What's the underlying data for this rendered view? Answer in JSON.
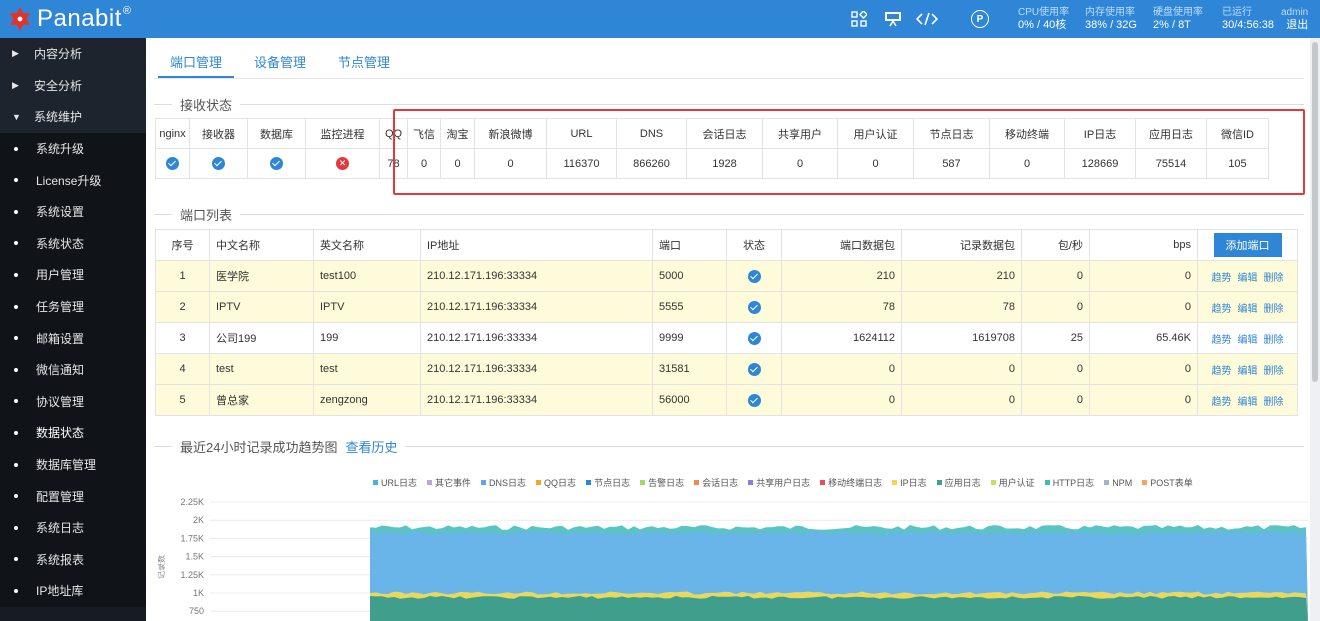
{
  "topbar": {
    "brand": "Panabit",
    "brand_mark": "®",
    "icons": [
      "apps-icon",
      "monitor-icon",
      "code-icon"
    ],
    "p_badge": "P",
    "stats": [
      {
        "label": "CPU使用率",
        "value": "0% / 40核"
      },
      {
        "label": "内存使用率",
        "value": "38% / 32G"
      },
      {
        "label": "硬盘使用率",
        "value": "2% / 8T"
      },
      {
        "label": "已运行",
        "value": "30/4:56:38"
      }
    ],
    "user": "admin",
    "logout": "退出"
  },
  "sidebar": {
    "items": [
      {
        "label": "内容分析",
        "kind": "parent",
        "expanded": false
      },
      {
        "label": "安全分析",
        "kind": "parent",
        "expanded": false
      },
      {
        "label": "系统维护",
        "kind": "parent",
        "expanded": true
      },
      {
        "label": "系统升级",
        "kind": "sub"
      },
      {
        "label": "License升级",
        "kind": "sub"
      },
      {
        "label": "系统设置",
        "kind": "sub"
      },
      {
        "label": "系统状态",
        "kind": "sub"
      },
      {
        "label": "用户管理",
        "kind": "sub"
      },
      {
        "label": "任务管理",
        "kind": "sub"
      },
      {
        "label": "邮箱设置",
        "kind": "sub"
      },
      {
        "label": "微信通知",
        "kind": "sub"
      },
      {
        "label": "协议管理",
        "kind": "sub"
      },
      {
        "label": "数据状态",
        "kind": "sub",
        "active": true
      },
      {
        "label": "数据库管理",
        "kind": "sub"
      },
      {
        "label": "配置管理",
        "kind": "sub"
      },
      {
        "label": "系统日志",
        "kind": "sub"
      },
      {
        "label": "系统报表",
        "kind": "sub"
      },
      {
        "label": "IP地址库",
        "kind": "sub"
      }
    ]
  },
  "tabs": [
    "端口管理",
    "设备管理",
    "节点管理"
  ],
  "receive": {
    "title": "接收状态",
    "headers": [
      "nginx",
      "接收器",
      "数据库",
      "监控进程",
      "QQ",
      "飞信",
      "淘宝",
      "新浪微博",
      "URL",
      "DNS",
      "会话日志",
      "共享用户",
      "用户认证",
      "节点日志",
      "移动终端",
      "IP日志",
      "应用日志",
      "微信ID"
    ],
    "status": [
      "ok",
      "ok",
      "ok",
      "error"
    ],
    "values": [
      "78",
      "0",
      "0",
      "0",
      "116370",
      "866260",
      "1928",
      "0",
      "0",
      "587",
      "0",
      "128669",
      "75514",
      "105"
    ]
  },
  "ports": {
    "title": "端口列表",
    "headers": [
      "序号",
      "中文名称",
      "英文名称",
      "IP地址",
      "端口",
      "状态",
      "端口数据包",
      "记录数据包",
      "包/秒",
      "bps"
    ],
    "add_label": "添加端口",
    "ops": [
      "趋势",
      "编辑",
      "删除"
    ],
    "rows": [
      {
        "no": "1",
        "cn": "医学院",
        "en": "test100",
        "ip": "210.12.171.196:33334",
        "port": "5000",
        "pkts": "210",
        "rec": "210",
        "pps": "0",
        "bps": "0",
        "hl": true
      },
      {
        "no": "2",
        "cn": "IPTV",
        "en": "IPTV",
        "ip": "210.12.171.196:33334",
        "port": "5555",
        "pkts": "78",
        "rec": "78",
        "pps": "0",
        "bps": "0",
        "hl": true
      },
      {
        "no": "3",
        "cn": "公司199",
        "en": "199",
        "ip": "210.12.171.196:33334",
        "port": "9999",
        "pkts": "1624112",
        "rec": "1619708",
        "pps": "25",
        "bps": "65.46K",
        "hl": false
      },
      {
        "no": "4",
        "cn": "test",
        "en": "test",
        "ip": "210.12.171.196:33334",
        "port": "31581",
        "pkts": "0",
        "rec": "0",
        "pps": "0",
        "bps": "0",
        "hl": true
      },
      {
        "no": "5",
        "cn": "曾总家",
        "en": "zengzong",
        "ip": "210.12.171.196:33334",
        "port": "56000",
        "pkts": "0",
        "rec": "0",
        "pps": "0",
        "bps": "0",
        "hl": true
      }
    ]
  },
  "trend": {
    "title": "最近24小时记录成功趋势图",
    "history_link": "查看历史"
  },
  "chart_data": {
    "type": "area",
    "title": "",
    "ylabel": "记录数",
    "yticks": [
      "2.25K",
      "2K",
      "1.75K",
      "1.5K",
      "1.25K",
      "1K",
      "750"
    ],
    "legend_position": "top-right",
    "series": [
      {
        "name": "URL日志",
        "color": "#45b5e0"
      },
      {
        "name": "其它事件",
        "color": "#b7a6e0"
      },
      {
        "name": "DNS日志",
        "color": "#5aa7ec"
      },
      {
        "name": "QQ日志",
        "color": "#f5a623"
      },
      {
        "name": "节点日志",
        "color": "#2f86d6"
      },
      {
        "name": "告警日志",
        "color": "#9fd86a"
      },
      {
        "name": "会话日志",
        "color": "#f08a4b"
      },
      {
        "name": "共享用户日志",
        "color": "#8a7be6"
      },
      {
        "name": "移动终端日志",
        "color": "#e84a5f"
      },
      {
        "name": "IP日志",
        "color": "#f6d54a"
      },
      {
        "name": "应用日志",
        "color": "#3da0a0"
      },
      {
        "name": "用户认证",
        "color": "#c6e05c"
      },
      {
        "name": "HTTP日志",
        "color": "#39c0b6"
      },
      {
        "name": "NPM",
        "color": "#a8b3c4"
      },
      {
        "name": "POST表单",
        "color": "#f2a65a"
      }
    ],
    "bands": [
      {
        "name": "URL日志",
        "level": 1900
      },
      {
        "name": "DNS日志",
        "level": 1820
      },
      {
        "name": "IP日志",
        "level": 1000
      },
      {
        "name": "应用日志",
        "level": 940
      }
    ],
    "ylim": [
      750,
      2250
    ]
  },
  "colors": {
    "accent": "#2f86d6",
    "sidebar": "#171c24",
    "error": "#e0393e",
    "highlight_row": "#fdfbd9",
    "red_box": "#e23a3a"
  }
}
